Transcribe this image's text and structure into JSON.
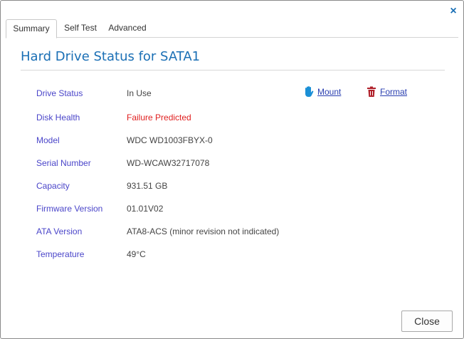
{
  "tabs": [
    {
      "label": "Summary"
    },
    {
      "label": "Self Test"
    },
    {
      "label": "Advanced"
    }
  ],
  "title": "Hard Drive Status for SATA1",
  "actions": {
    "mount": {
      "label": "Mount",
      "icon": "hand-icon",
      "color": "#1a8fd6"
    },
    "format": {
      "label": "Format",
      "icon": "trash-icon",
      "color": "#b0202a"
    }
  },
  "fields": [
    {
      "label": "Drive Status",
      "value": "In Use"
    },
    {
      "label": "Disk Health",
      "value": "Failure Predicted",
      "status_color": "#e02020"
    },
    {
      "label": "Model",
      "value": "WDC WD1003FBYX-0"
    },
    {
      "label": "Serial Number",
      "value": "WD-WCAW32717078"
    },
    {
      "label": "Capacity",
      "value": "931.51 GB"
    },
    {
      "label": "Firmware Version",
      "value": "01.01V02"
    },
    {
      "label": "ATA Version",
      "value": "ATA8-ACS (minor revision not indicated)"
    },
    {
      "label": "Temperature",
      "value": "49°C"
    }
  ],
  "footer": {
    "close_label": "Close"
  },
  "close_glyph": "×",
  "colors": {
    "accent": "#1a6fb5",
    "label": "#4a45c9",
    "link": "#2a3fb0"
  }
}
